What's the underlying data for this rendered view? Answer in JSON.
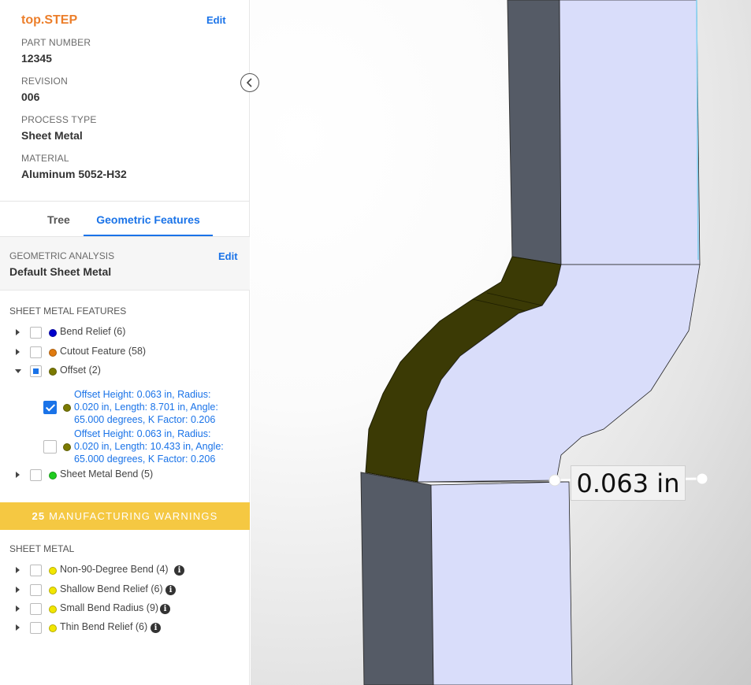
{
  "part": {
    "filename": "top.STEP",
    "edit_label": "Edit",
    "fields": [
      {
        "label": "PART NUMBER",
        "value": "12345"
      },
      {
        "label": "REVISION",
        "value": "006"
      },
      {
        "label": "PROCESS TYPE",
        "value": "Sheet Metal"
      },
      {
        "label": "MATERIAL",
        "value": "Aluminum 5052-H32"
      }
    ]
  },
  "tabs": [
    {
      "label": "Tree",
      "active": false
    },
    {
      "label": "Geometric Features",
      "active": true
    }
  ],
  "analysis": {
    "label": "GEOMETRIC ANALYSIS",
    "value": "Default Sheet Metal",
    "edit_label": "Edit"
  },
  "features": {
    "title": "SHEET METAL FEATURES",
    "items": [
      {
        "label": "Bend Relief (6)",
        "color": "#0000cc",
        "expanded": false,
        "checked": false
      },
      {
        "label": "Cutout Feature (58)",
        "color": "#e07b10",
        "expanded": false,
        "checked": false
      },
      {
        "label": "Offset (2)",
        "color": "#7b7a00",
        "expanded": true,
        "checked": "partial"
      },
      {
        "label": "Sheet Metal Bend (5)",
        "color": "#1fcc1f",
        "expanded": false,
        "checked": false
      }
    ],
    "offset_children": [
      {
        "text": "Offset Height: 0.063 in, Radius: 0.020 in, Length: 8.701 in, Angle: 65.000 degrees, K Factor: 0.206",
        "checked": true,
        "color": "#7b7a00"
      },
      {
        "text": "Offset Height: 0.063 in, Radius: 0.020 in, Length: 10.433 in, Angle: 65.000 degrees, K Factor: 0.206",
        "checked": false,
        "color": "#7b7a00"
      }
    ]
  },
  "warnings": {
    "count": "25",
    "label": "MANUFACTURING WARNINGS",
    "color": "#f5c842"
  },
  "warning_groups": {
    "title": "SHEET METAL",
    "items": [
      {
        "label": "Non-90-Degree Bend (4)",
        "color": "#f2e600",
        "icon": "info-icon"
      },
      {
        "label": "Shallow Bend Relief (6)",
        "color": "#f2e600",
        "icon": "info-icon"
      },
      {
        "label": "Small Bend Radius (9)",
        "color": "#f2e600",
        "icon": "info-icon"
      },
      {
        "label": "Thin Bend Relief (6)",
        "color": "#f2e600",
        "icon": "info-icon"
      }
    ]
  },
  "viewport": {
    "measurement": "0.063 in"
  }
}
